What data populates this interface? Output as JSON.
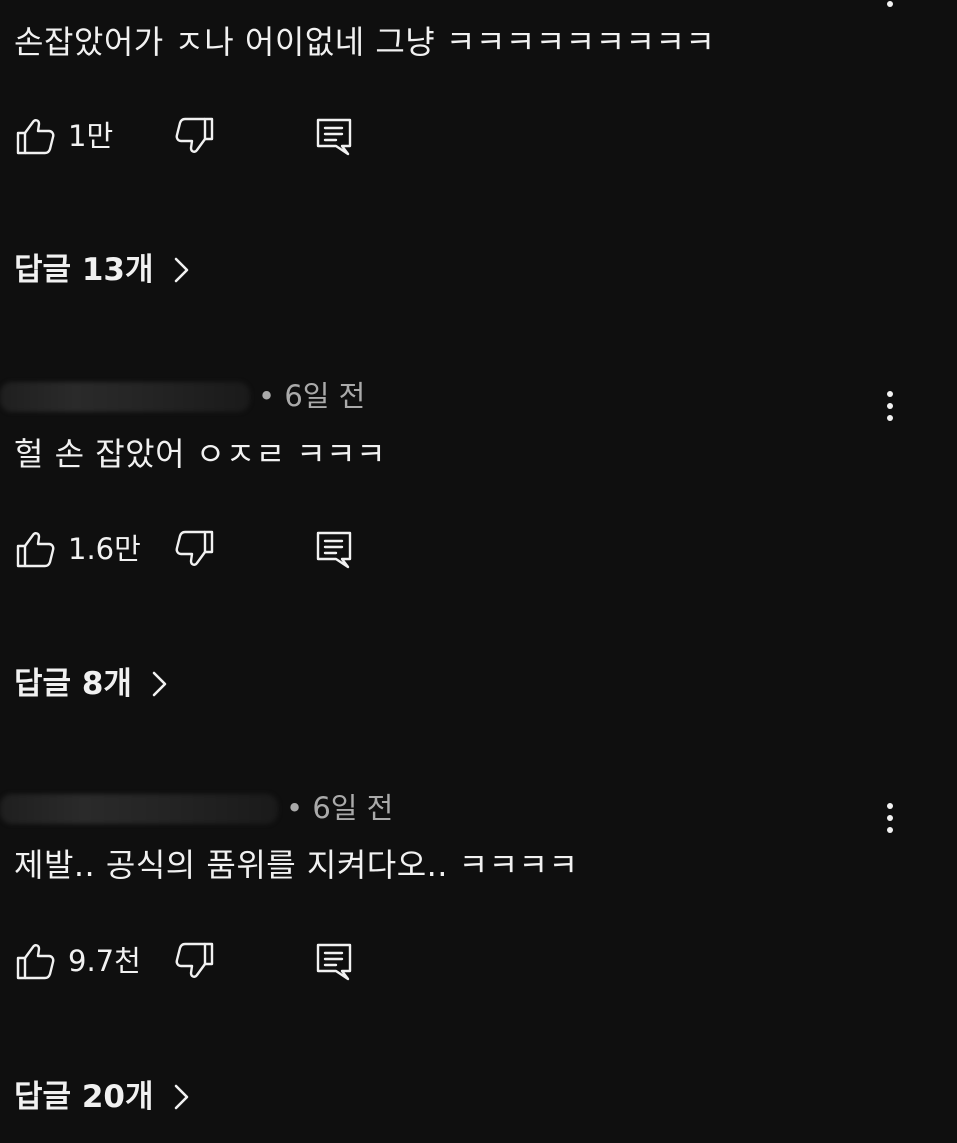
{
  "comments": [
    {
      "meta_time": "",
      "text": "손잡았어가 ㅈ나 어이없네 그냥 ㅋㅋㅋㅋㅋㅋㅋㅋㅋ",
      "likes": "1만",
      "replies_label": "답글 13개"
    },
    {
      "meta_time": "• 6일 전",
      "text": "헐 손 잡았어 ㅇㅈㄹ ㅋㅋㅋ",
      "likes": "1.6만",
      "replies_label": "답글 8개"
    },
    {
      "meta_time": "• 6일 전",
      "text": "제발..  공식의 품위를 지켜다오.. ㅋㅋㅋㅋ",
      "likes": "9.7천",
      "replies_label": "답글 20개"
    }
  ],
  "icons": {
    "like": "thumbs-up-icon",
    "dislike": "thumbs-down-icon",
    "reply": "comment-reply-icon",
    "menu": "more-vertical-icon",
    "chevron": "chevron-right-icon"
  },
  "colors": {
    "background": "#0f0f0f",
    "text": "#f1f1f1",
    "secondary_text": "#aaaaaa"
  }
}
